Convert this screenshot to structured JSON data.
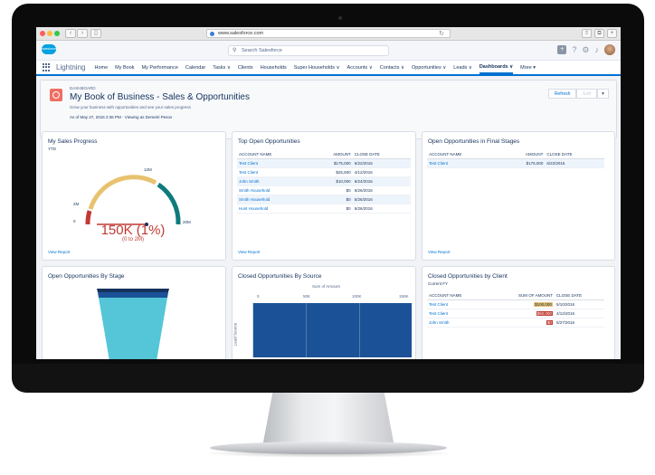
{
  "browser": {
    "url": "www.salesforce.com"
  },
  "header": {
    "logo_text": "salesforce",
    "search_placeholder": "Search Salesforce"
  },
  "nav": {
    "app_name": "Lightning",
    "items": [
      {
        "label": "Home"
      },
      {
        "label": "My Book"
      },
      {
        "label": "My Performance"
      },
      {
        "label": "Calendar"
      },
      {
        "label": "Tasks ∨"
      },
      {
        "label": "Clients"
      },
      {
        "label": "Households"
      },
      {
        "label": "Super Households ∨"
      },
      {
        "label": "Accounts ∨"
      },
      {
        "label": "Contacts ∨"
      },
      {
        "label": "Opportunities ∨"
      },
      {
        "label": "Leads ∨"
      },
      {
        "label": "Dashboards ∨"
      },
      {
        "label": "More ▾"
      }
    ],
    "active_index": 12
  },
  "dashboard": {
    "label": "DASHBOARD",
    "title": "My Book of Business - Sales & Opportunities",
    "subtitle": "Grow your business with opportunities and see your sales progress",
    "as_of": "As of May 27, 2016 2:36 PM · Viewing as Demetri Pesov",
    "refresh_label": "Refresh",
    "edit_label": "Edit"
  },
  "sales_progress": {
    "title": "My Sales Progress",
    "subtitle": "YTD",
    "labels": [
      "0",
      "2M",
      "12M",
      "20M"
    ],
    "value_text": "150K (1%)",
    "range_text": "(0 to 2M)",
    "view_report": "View Report",
    "progress_fraction": 0.01
  },
  "top_open": {
    "title": "Top Open Opportunities",
    "headers": [
      "ACCOUNT NAME",
      "AMOUNT",
      "CLOSE DATE"
    ],
    "rows": [
      [
        "Test Client",
        "$175,000",
        "6/22/2016"
      ],
      [
        "Test Client",
        "$25,500",
        "4/12/2016"
      ],
      [
        "John Smith",
        "$10,000",
        "6/24/2016"
      ],
      [
        "Smith Household",
        "$0",
        "5/26/2016"
      ],
      [
        "Smith Household",
        "$0",
        "5/26/2016"
      ],
      [
        "Hunt Household",
        "$0",
        "5/26/2016"
      ]
    ],
    "view_report": "View Report"
  },
  "final_stages": {
    "title": "Open Opportunities in Final Stages",
    "headers": [
      "ACCOUNT NAME",
      "AMOUNT",
      "CLOSE DATE"
    ],
    "rows": [
      [
        "Test Client",
        "$175,000",
        "6/22/2016"
      ]
    ],
    "view_report": "View Report"
  },
  "by_stage": {
    "title": "Open Opportunities By Stage"
  },
  "by_source": {
    "title": "Closed Opportunities By Source",
    "axis_title": "Sum of Amount",
    "ticks": [
      "0",
      "50K",
      "100K",
      "150K"
    ],
    "y_label": "Lead Source"
  },
  "by_client": {
    "title": "Closed Opportunities by Client",
    "subtitle": "Current FY",
    "headers": [
      "ACCOUNT NAME",
      "SUM OF AMOUNT",
      "CLOSE DATE"
    ],
    "rows": [
      [
        "Test Client",
        "$100,000",
        "5/10/2016"
      ],
      [
        "Test Client",
        "$50,000",
        "4/12/2016"
      ],
      [
        "John Smith",
        "$0",
        "5/27/2016"
      ]
    ],
    "colors": [
      "#e8c26e",
      "#c23934",
      "#c23934"
    ]
  }
}
